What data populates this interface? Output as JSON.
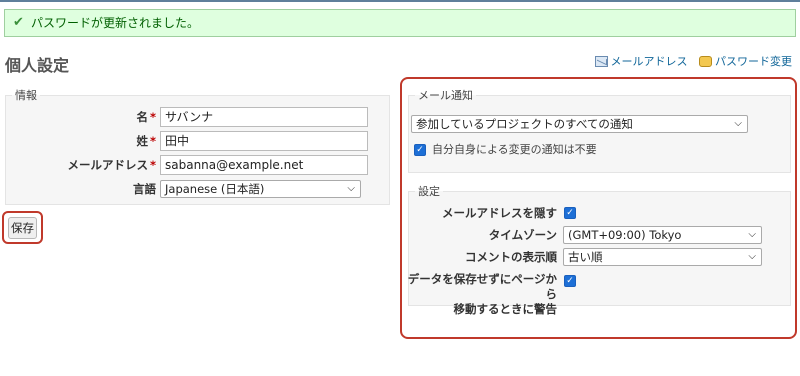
{
  "flash": {
    "message": "パスワードが更新されました。"
  },
  "page": {
    "title": "個人設定"
  },
  "contextual": {
    "email_link": "メールアドレス",
    "password_link": "パスワード変更"
  },
  "info": {
    "legend": "情報",
    "firstname": {
      "label": "名",
      "value": "サバンナ"
    },
    "lastname": {
      "label": "姓",
      "value": "田中"
    },
    "email": {
      "label": "メールアドレス",
      "value": "sabanna@example.net"
    },
    "language": {
      "label": "言語",
      "value": "Japanese (日本語)"
    }
  },
  "save_button": "保存",
  "mail_notification": {
    "legend": "メール通知",
    "option": "参加しているプロジェクトのすべての通知",
    "no_self_notified": "自分自身による変更の通知は不要"
  },
  "preferences": {
    "legend": "設定",
    "hide_mail": {
      "label": "メールアドレスを隠す",
      "checked": true
    },
    "time_zone": {
      "label": "タイムゾーン",
      "value": "(GMT+09:00) Tokyo"
    },
    "comments_sorting": {
      "label": "コメントの表示順",
      "value": "古い順"
    },
    "warn_unsaved": {
      "label_line1": "データを保存せずにページから",
      "label_line2": "移動するときに警告",
      "checked": true
    }
  }
}
